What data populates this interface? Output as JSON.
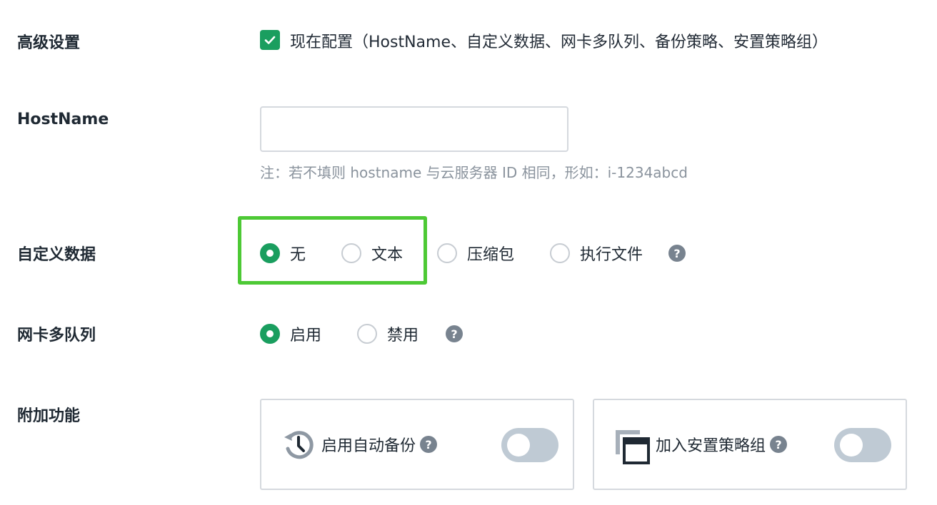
{
  "advanced": {
    "label": "高级设置",
    "checkbox_checked": true,
    "checkbox_text": "现在配置（HostName、自定义数据、网卡多队列、备份策略、安置策略组）"
  },
  "hostname": {
    "label": "HostName",
    "value": "",
    "placeholder": "",
    "note": "注：若不填则 hostname 与云服务器 ID 相同，形如：i-1234abcd"
  },
  "custom_data": {
    "label": "自定义数据",
    "options": [
      "无",
      "文本",
      "压缩包",
      "执行文件"
    ],
    "selected": "无",
    "help_icon": "question-circle-icon"
  },
  "nic_multiqueue": {
    "label": "网卡多队列",
    "options": [
      "启用",
      "禁用"
    ],
    "selected": "启用",
    "help_icon": "question-circle-icon"
  },
  "addons": {
    "label": "附加功能",
    "cards": [
      {
        "icon": "backup-history-icon",
        "title": "启用自动备份",
        "enabled": false
      },
      {
        "icon": "placement-group-icon",
        "title": "加入安置策略组",
        "enabled": false
      }
    ]
  },
  "colors": {
    "accent": "#1a9e5f",
    "highlight": "#4dc935",
    "toggle_off": "#bfcad4",
    "help_icon_bg": "#78838f"
  },
  "help_glyph": "?"
}
